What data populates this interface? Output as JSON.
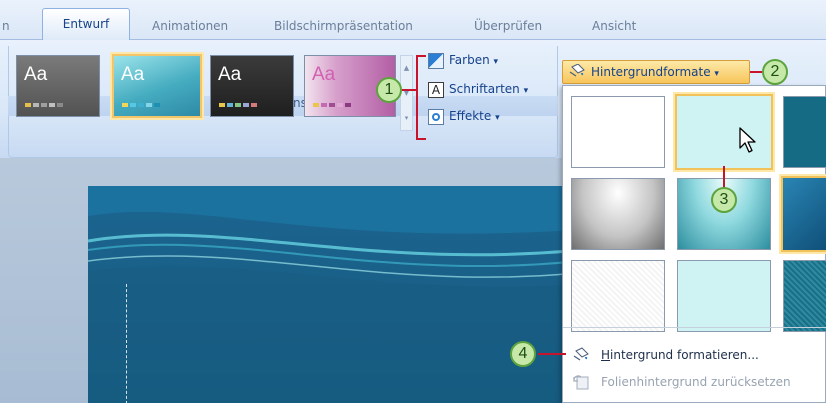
{
  "tabs": [
    {
      "label": "n",
      "active": false
    },
    {
      "label": "Entwurf",
      "active": true
    },
    {
      "label": "Animationen",
      "active": false
    },
    {
      "label": "Bildschirmpräsentation",
      "active": false
    },
    {
      "label": "Überprüfen",
      "active": false
    },
    {
      "label": "Ansicht",
      "active": false
    }
  ],
  "designs": {
    "group_label": "Designs",
    "thumb_text": "Aa",
    "thumbs": [
      {
        "name": "gray",
        "bg": "#6b6b6b",
        "selected": false
      },
      {
        "name": "teal-gradient",
        "bg": "#5fb9c6",
        "selected": true
      },
      {
        "name": "dark",
        "bg": "#2f2f2f",
        "selected": false
      },
      {
        "name": "pink",
        "bg": "#c276b3",
        "selected": false
      }
    ],
    "items": {
      "colors": "Farben",
      "fonts": "Schriftarten",
      "effects": "Effekte"
    },
    "dropdown_arrow": "▾"
  },
  "background_styles": {
    "button_label": "Hintergrundformate",
    "menu": {
      "format_label": "Hintergrund formatieren...",
      "format_mnemonic": "H",
      "format_rest": "intergrund formatieren...",
      "reset_label": "Folienhintergrund zurücksetzen",
      "reset_pre": "Folienhinter",
      "reset_mnemonic": "g",
      "reset_post": "rund zurücksetzen"
    }
  },
  "callouts": {
    "one": "1",
    "two": "2",
    "three": "3",
    "four": "4"
  },
  "colors": {
    "accent": "#f8c55a",
    "callout_fill": "#c6e9a9",
    "callout_border": "#5da33e",
    "annotation_red": "#c7132b"
  }
}
